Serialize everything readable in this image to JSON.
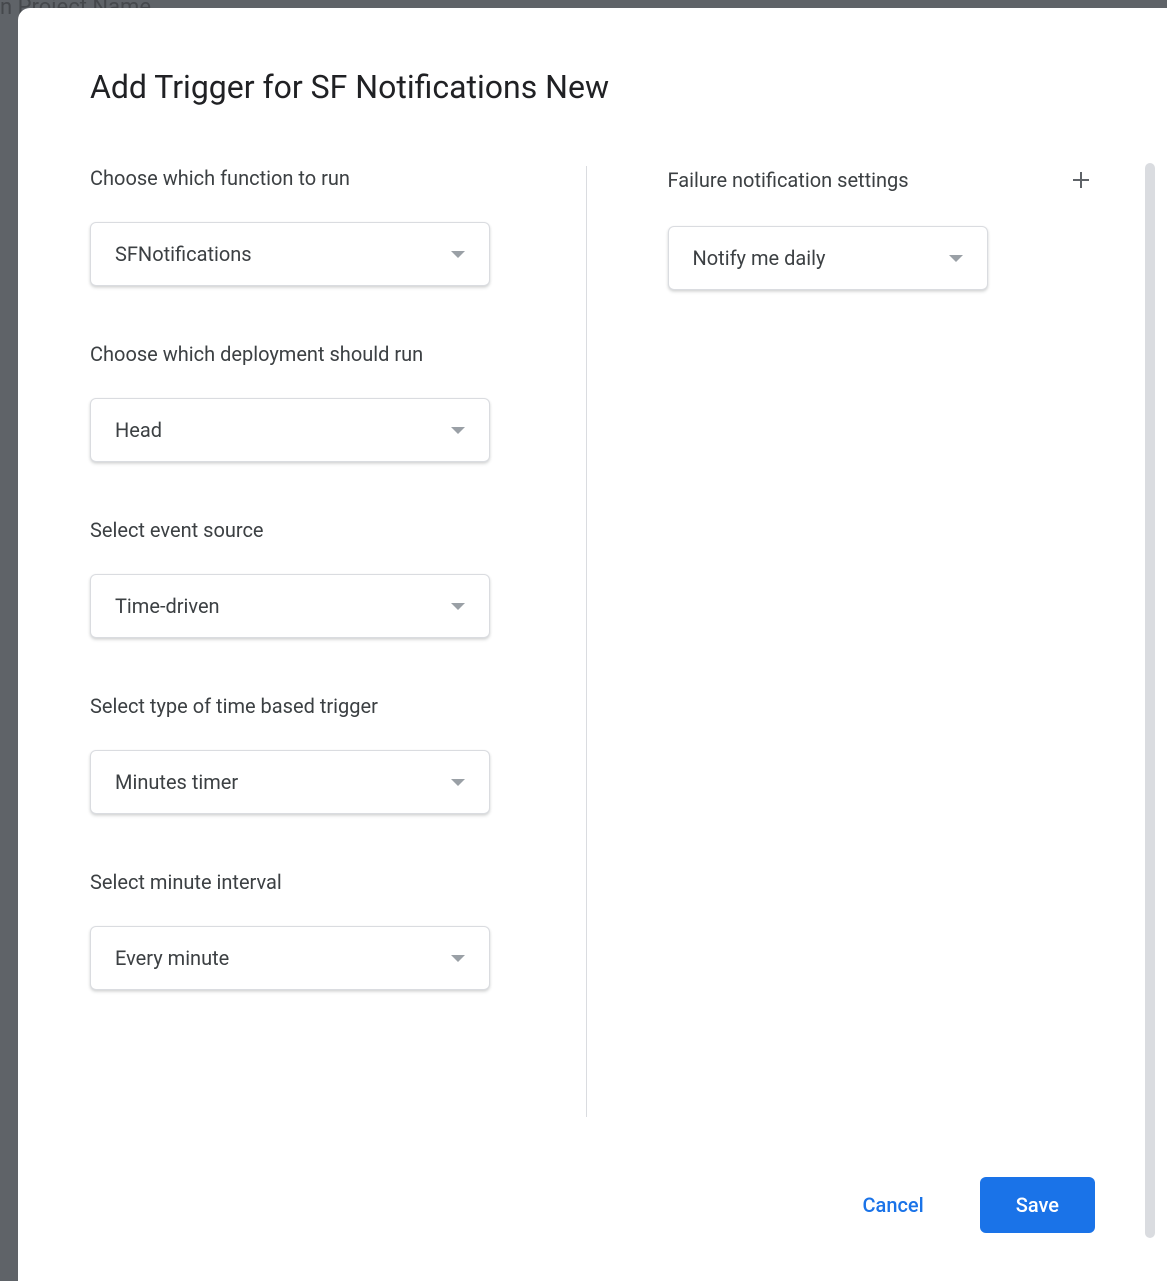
{
  "backdrop": {
    "text": "n Project Name"
  },
  "modal": {
    "title": "Add Trigger for SF Notifications New"
  },
  "left": {
    "function": {
      "label": "Choose which function to run",
      "value": "SFNotifications"
    },
    "deployment": {
      "label": "Choose which deployment should run",
      "value": "Head"
    },
    "event_source": {
      "label": "Select event source",
      "value": "Time-driven"
    },
    "trigger_type": {
      "label": "Select type of time based trigger",
      "value": "Minutes timer"
    },
    "interval": {
      "label": "Select minute interval",
      "value": "Every minute"
    }
  },
  "right": {
    "header": "Failure notification settings",
    "notify": {
      "value": "Notify me daily"
    }
  },
  "footer": {
    "cancel": "Cancel",
    "save": "Save"
  }
}
